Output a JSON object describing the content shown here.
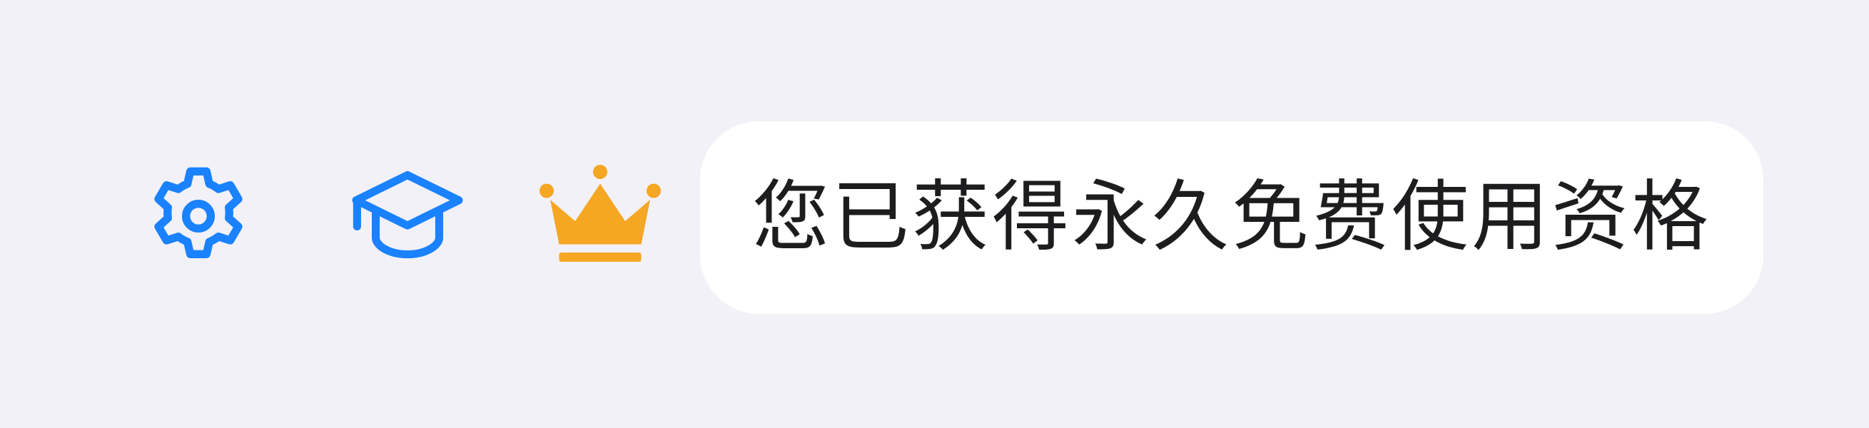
{
  "toolbar": {
    "settings": {
      "icon": "gear-icon"
    },
    "academy": {
      "icon": "graduation-cap-icon"
    },
    "vip": {
      "icon": "crown-icon"
    }
  },
  "status": {
    "message": "您已获得永久免费使用资格"
  },
  "colors": {
    "background": "#f2f1f7",
    "accent_blue": "#1a82ff",
    "crown_gold": "#f5a623",
    "pill_bg": "#ffffff",
    "text": "#1d1d1f"
  }
}
